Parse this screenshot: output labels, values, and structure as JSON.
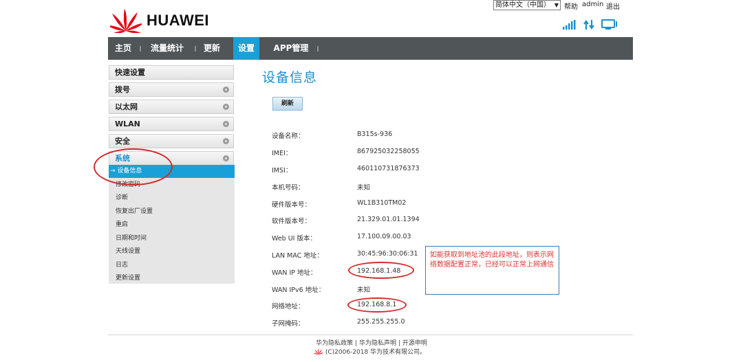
{
  "header": {
    "brand": "HUAWEI",
    "language": "简体中文（中国）",
    "help": "帮助",
    "user": "admin",
    "logout": "退出",
    "status_icons": [
      "signal-bars-icon",
      "data-transfer-icon",
      "monitor-icon"
    ]
  },
  "nav": {
    "items": [
      {
        "label": "主页"
      },
      {
        "label": "流量统计"
      },
      {
        "label": "更新"
      },
      {
        "label": "设置",
        "active": true
      },
      {
        "label": "APP管理"
      }
    ]
  },
  "sidebar": {
    "sections": [
      {
        "label": "快速设置"
      },
      {
        "label": "拨号"
      },
      {
        "label": "以太网"
      },
      {
        "label": "WLAN"
      },
      {
        "label": "安全"
      },
      {
        "label": "系统",
        "expanded": true
      }
    ],
    "system_items": [
      {
        "label": "设备信息",
        "active": true
      },
      {
        "label": "修改密码"
      },
      {
        "label": "诊断"
      },
      {
        "label": "恢复出厂设置"
      },
      {
        "label": "重启"
      },
      {
        "label": "日期和时间"
      },
      {
        "label": "天线设置"
      },
      {
        "label": "日志"
      },
      {
        "label": "更新设置"
      }
    ],
    "active_marker": "→"
  },
  "main": {
    "title": "设备信息",
    "refresh_label": "刷新",
    "rows": [
      {
        "label": "设备名称：",
        "value": "B315s-936"
      },
      {
        "label": "IMEI：",
        "value": "867925032258055"
      },
      {
        "label": "IMSI：",
        "value": "460110731876373"
      },
      {
        "label": "本机号码：",
        "value": "未知"
      },
      {
        "label": "硬件版本号：",
        "value": "WL1B310TM02"
      },
      {
        "label": "软件版本号：",
        "value": "21.329.01.01.1394"
      },
      {
        "label": "Web UI 版本：",
        "value": "17.100.09.00.03"
      },
      {
        "label": "LAN MAC 地址：",
        "value": "30:45:96:30:06:31"
      },
      {
        "label": "WAN IP 地址：",
        "value": "192.168.1.48"
      },
      {
        "label": "WAN IPv6 地址：",
        "value": "未知"
      },
      {
        "label": "网络地址：",
        "value": "192.168.8.1"
      },
      {
        "label": "子网掩码：",
        "value": "255.255.255.0"
      }
    ]
  },
  "annotation": {
    "note": "如能获取到地址池的此段地址，则表示网络数据配置正常，已经可以正常上网通信",
    "color": "#d42a2a"
  },
  "footer": {
    "links": [
      "华为隐私政策",
      "华为隐私声明",
      "开源申明"
    ],
    "separator": "|",
    "copyright": "(C)2006-2018 华为技术有限公司。"
  },
  "colors": {
    "accent": "#1aa0d8",
    "nav_bg": "#505558",
    "title": "#1a8fcf",
    "brand_red": "#e60012"
  }
}
